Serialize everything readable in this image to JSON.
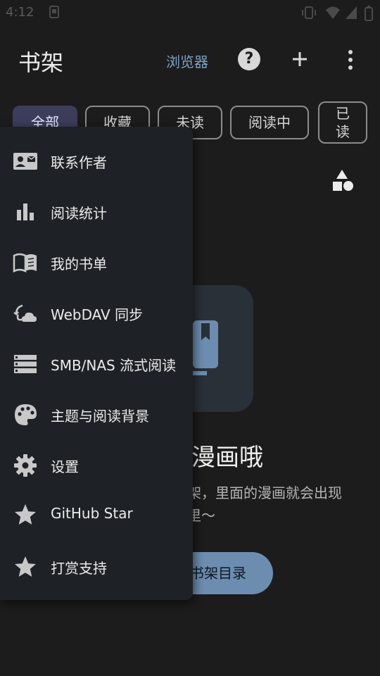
{
  "status_bar": {
    "time": "4:12"
  },
  "app_bar": {
    "title": "书架",
    "browser_link": "浏览器",
    "help_icon_char": "?"
  },
  "filter_chips": [
    {
      "label": "全部",
      "active": true
    },
    {
      "label": "收藏",
      "active": false
    },
    {
      "label": "未读",
      "active": false
    },
    {
      "label": "阅读中",
      "active": false
    },
    {
      "label": "已\n读",
      "active": false
    }
  ],
  "empty_state": {
    "title": "漫画哦",
    "description_line1": "架，里面的漫画就会出现",
    "description_line2": "里～",
    "button_label": "书架目录"
  },
  "menu": {
    "items": [
      {
        "label": "联系作者",
        "icon": "contact-card-icon"
      },
      {
        "label": "阅读统计",
        "icon": "bar-chart-icon"
      },
      {
        "label": "我的书单",
        "icon": "open-book-icon"
      },
      {
        "label": "WebDAV 同步",
        "icon": "cloud-sync-icon"
      },
      {
        "label": "SMB/NAS 流式阅读",
        "icon": "storage-icon"
      },
      {
        "label": "主题与阅读背景",
        "icon": "palette-icon"
      },
      {
        "label": "设置",
        "icon": "gear-icon"
      },
      {
        "label": "GitHub Star",
        "icon": "star-icon"
      },
      {
        "label": "打赏支持",
        "icon": "star-icon"
      }
    ]
  },
  "colors": {
    "background": "#1c1c1c",
    "accent": "#7ea3c8",
    "menu_bg": "#1e2226",
    "chip_active": "#3b3d5a",
    "button_bg": "#6c8db0"
  }
}
